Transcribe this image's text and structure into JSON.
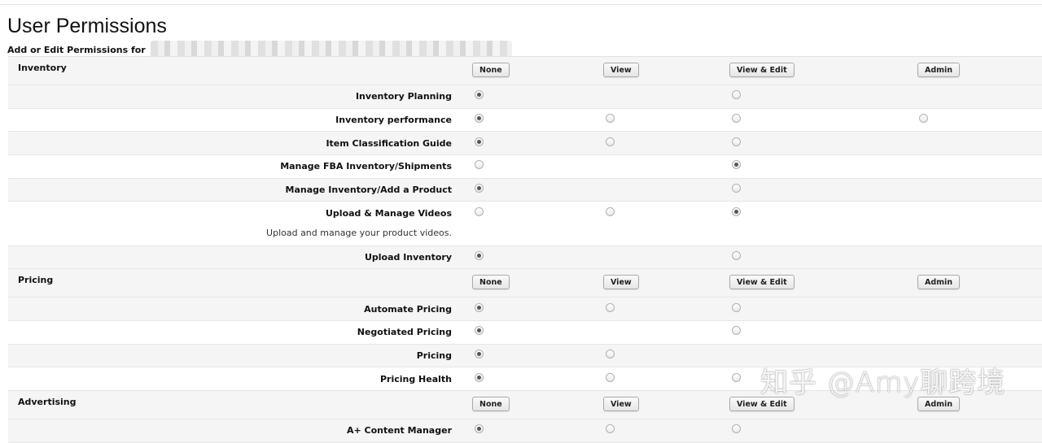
{
  "page": {
    "title": "User Permissions",
    "subtitle": "Add or Edit Permissions for"
  },
  "columns": [
    "None",
    "View",
    "View & Edit",
    "Admin"
  ],
  "sections": [
    {
      "name": "Inventory",
      "permissions": [
        {
          "label": "Inventory Planning",
          "options": [
            "checked",
            null,
            "unchecked",
            null
          ]
        },
        {
          "label": "Inventory performance",
          "options": [
            "checked",
            "unchecked",
            "unchecked",
            "unchecked"
          ]
        },
        {
          "label": "Item Classification Guide",
          "options": [
            "checked",
            "unchecked",
            "unchecked",
            null
          ]
        },
        {
          "label": "Manage FBA Inventory/Shipments",
          "options": [
            "unchecked",
            null,
            "checked",
            null
          ]
        },
        {
          "label": "Manage Inventory/Add a Product",
          "options": [
            "checked",
            null,
            "unchecked",
            null
          ]
        },
        {
          "label": "Upload & Manage Videos",
          "description": "Upload and manage your product videos.",
          "options": [
            "unchecked",
            "unchecked",
            "checked",
            null
          ]
        },
        {
          "label": "Upload Inventory",
          "options": [
            "checked",
            null,
            "unchecked",
            null
          ]
        }
      ]
    },
    {
      "name": "Pricing",
      "permissions": [
        {
          "label": "Automate Pricing",
          "options": [
            "checked",
            "unchecked",
            "unchecked",
            null
          ]
        },
        {
          "label": "Negotiated Pricing",
          "options": [
            "checked",
            null,
            "unchecked",
            null
          ]
        },
        {
          "label": "Pricing",
          "options": [
            "checked",
            "unchecked",
            null,
            null
          ]
        },
        {
          "label": "Pricing Health",
          "options": [
            "checked",
            "unchecked",
            "unchecked",
            null
          ]
        }
      ]
    },
    {
      "name": "Advertising",
      "permissions": [
        {
          "label": "A+ Content Manager",
          "options": [
            "checked",
            "unchecked",
            "unchecked",
            null
          ]
        }
      ]
    }
  ],
  "watermark": "知乎 @Amy聊跨境",
  "colors": {
    "row_shade": "#f5f5f5",
    "row_white": "#ffffff",
    "border": "#e6e6e6",
    "radio_dot": "#555555"
  }
}
